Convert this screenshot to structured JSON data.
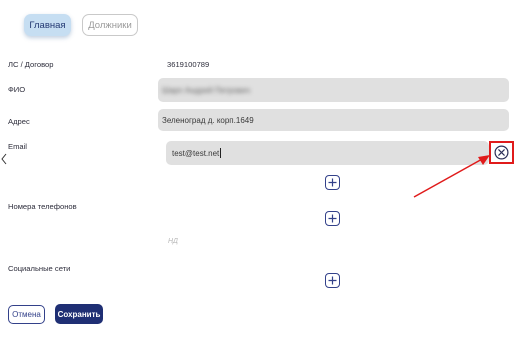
{
  "tabs": [
    {
      "label": "Главная",
      "active": true
    },
    {
      "label": "Должники",
      "active": false
    }
  ],
  "fields": {
    "contract": {
      "label": "ЛС / Договор",
      "value": "3619100789"
    },
    "fio": {
      "label": "ФИО",
      "value": "Шарп Андрей Петрович"
    },
    "address": {
      "label": "Адрес",
      "value": "Зеленоград д. корп.1649"
    },
    "email": {
      "label": "Email",
      "value": "test@test.net"
    },
    "phones": {
      "label": "Номера телефонов",
      "placeholder": "НД"
    },
    "social": {
      "label": "Социальные сети"
    }
  },
  "actions": {
    "cancel_label": "Отмена",
    "save_label": "Сохранить"
  },
  "icons": {
    "clear": "close-circle-icon",
    "add": "plus-icon",
    "back": "chevron-left-icon"
  },
  "colors": {
    "primary": "#1f2f74",
    "tab_active_bg": "#c6def2",
    "field_bg": "#e0e0e0",
    "highlight": "#e01b1b"
  }
}
